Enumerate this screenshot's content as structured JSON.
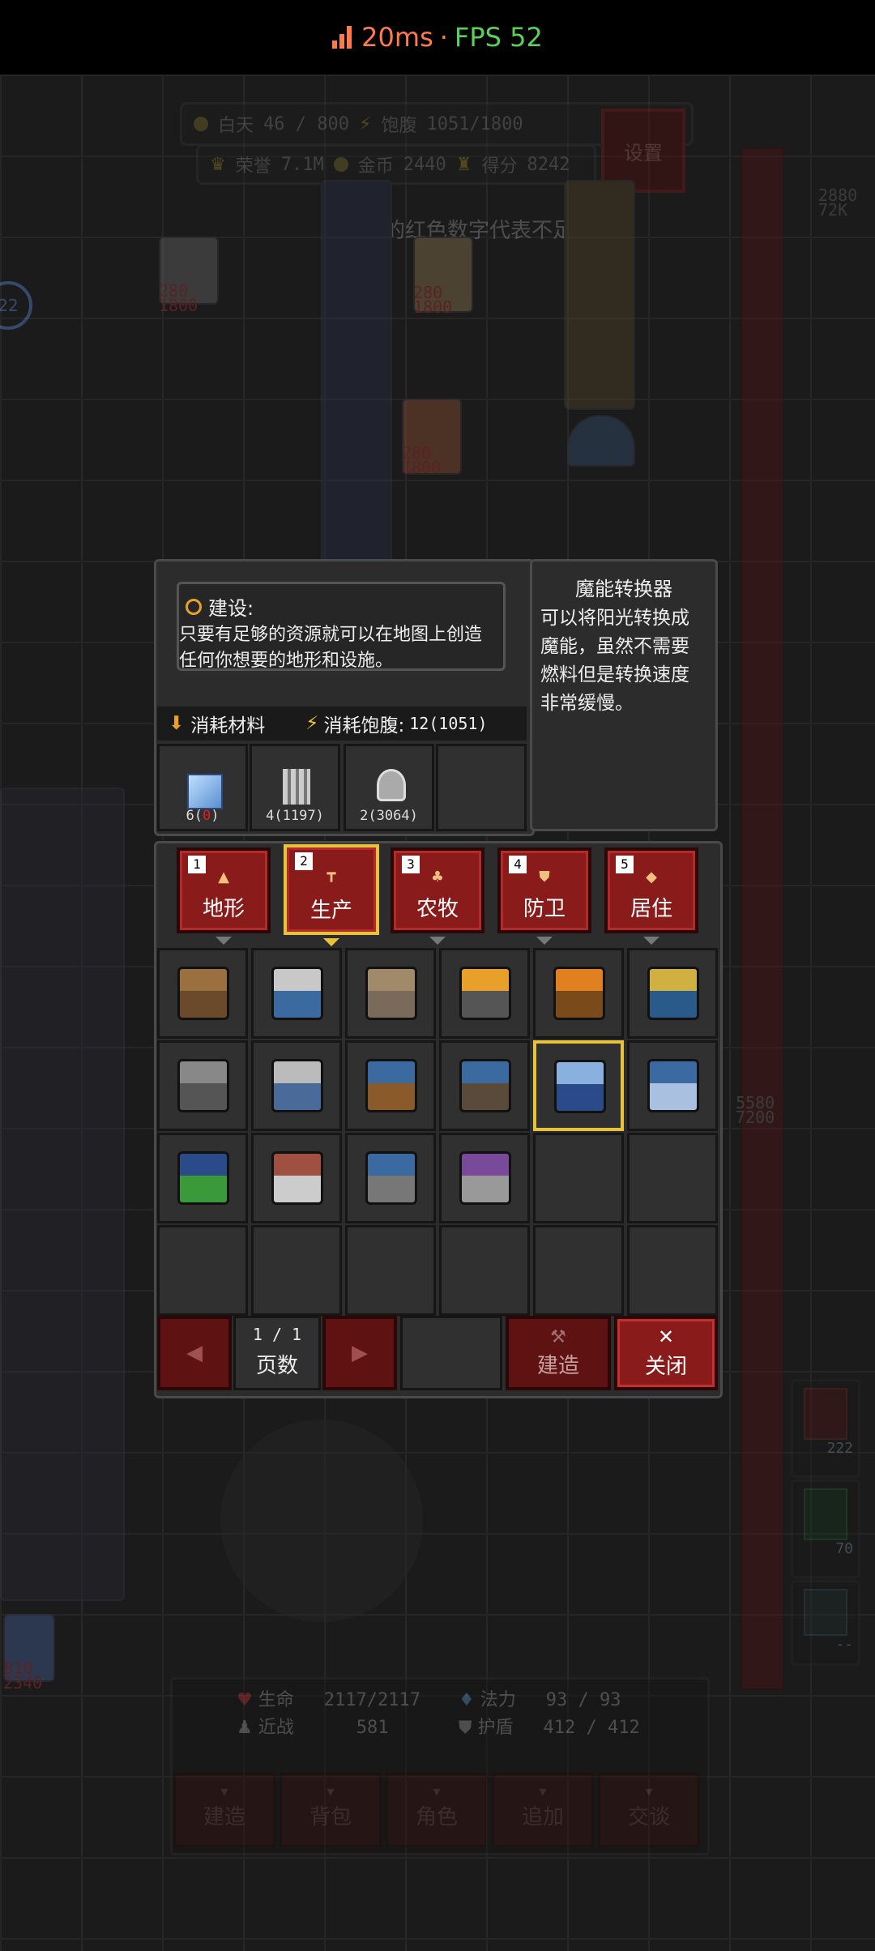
{
  "status": {
    "latency": "20ms",
    "separator": "·",
    "fps": "FPS 52"
  },
  "hud_top": {
    "day": "白天",
    "day_value": "46 / 800",
    "satiety": "饱腹",
    "satiety_value": "1051/1800",
    "honor": "荣誉",
    "honor_value": "7.1M",
    "gold": "金币",
    "gold_value": "2440",
    "score": "得分",
    "score_value": "8242",
    "settings_label": "设置",
    "hint": "游戏中的红色数字代表不足"
  },
  "bg_numbers": {
    "pair_a": [
      "280",
      "1800"
    ],
    "pair_b": [
      "2880",
      "72K"
    ],
    "pair_c": [
      "5580",
      "7200"
    ],
    "pair_d": [
      "810",
      "2340"
    ],
    "left_circle": "22"
  },
  "build_panel": {
    "info_title": "建设:",
    "info_text": "只要有足够的资源就可以在地图上创造任何你想要的地形和设施。",
    "materials_label": "消耗材料",
    "satiety_cost_label": "消耗饱腹:",
    "satiety_cost_value": "12(1051)",
    "materials": [
      {
        "icon": "glass-block-icon",
        "qty": "6(",
        "qty_red": "0",
        "qty_end": ")"
      },
      {
        "icon": "iron-pillar-icon",
        "qty": "4(1197)"
      },
      {
        "icon": "gear-part-icon",
        "qty": "2(3064)"
      }
    ],
    "detail_title": "魔能转换器",
    "detail_text": "可以将阳光转换成魔能，虽然不需要燃料但是转换速度非常缓慢。",
    "tabs": [
      {
        "num": "1",
        "label": "地形",
        "glyph": "▲"
      },
      {
        "num": "2",
        "label": "生产",
        "glyph": "┳"
      },
      {
        "num": "3",
        "label": "农牧",
        "glyph": "♣"
      },
      {
        "num": "4",
        "label": "防卫",
        "glyph": "⛊"
      },
      {
        "num": "5",
        "label": "居住",
        "glyph": "◆"
      }
    ],
    "items": [
      "workbench-icon",
      "sawmill-icon",
      "stove-icon",
      "furnace-icon",
      "oven-icon",
      "kiln-icon",
      "anvil-icon",
      "machine-press-icon",
      "chest-machine-icon",
      "grinder-icon",
      "magic-converter-icon",
      "tank-pair-icon",
      "green-tanks-icon",
      "bottle-rack-icon",
      "blue-cabinet-icon",
      "purple-cabinet-icon"
    ],
    "page_value": "1 / 1",
    "page_label": "页数",
    "prev_label": "◀",
    "next_label": "▶",
    "build_label": "建造",
    "close_label": "关闭"
  },
  "stats": {
    "hp_label": "生命",
    "hp_value": "2117/2117",
    "mp_label": "法力",
    "mp_value": "93 / 93",
    "melee_label": "近战",
    "melee_value": "581",
    "shield_label": "护盾",
    "shield_value": "412 / 412"
  },
  "bottom_buttons": [
    "建造",
    "背包",
    "角色",
    "追加",
    "交谈"
  ],
  "side_slots": [
    {
      "icon": "sword-icon",
      "count": "222"
    },
    {
      "icon": "eye-icon",
      "count": "70"
    },
    {
      "icon": "shield-icon",
      "count": "--"
    }
  ]
}
